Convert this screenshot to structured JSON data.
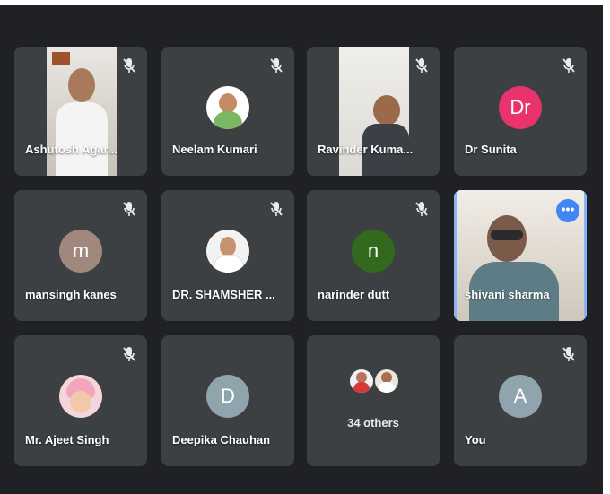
{
  "participants": [
    {
      "name": "Ashutosh Agar...",
      "type": "video",
      "muted": true
    },
    {
      "name": "Neelam Kumari",
      "type": "photo",
      "muted": true
    },
    {
      "name": "Ravinder Kuma...",
      "type": "video",
      "muted": true
    },
    {
      "name": "Dr Sunita",
      "type": "initials",
      "initials": "Dr",
      "color": "#e8336d",
      "muted": true
    },
    {
      "name": "mansingh kanes",
      "type": "initials",
      "initials": "m",
      "color": "#a1887f",
      "muted": true
    },
    {
      "name": "DR. SHAMSHER ...",
      "type": "photo",
      "muted": true
    },
    {
      "name": "narinder dutt",
      "type": "initials",
      "initials": "n",
      "color": "#33691e",
      "muted": true
    },
    {
      "name": "shivani sharma",
      "type": "video",
      "muted": false,
      "speaking": true,
      "more_icon": "more-horiz-icon"
    },
    {
      "name": "Mr. Ajeet Singh",
      "type": "photo",
      "muted": true
    },
    {
      "name": "Deepika Chauhan",
      "type": "initials",
      "initials": "D",
      "color": "#90a4ae",
      "muted": false
    },
    {
      "others_label": "34 others",
      "type": "others"
    },
    {
      "name": "You",
      "type": "initials",
      "initials": "A",
      "color": "#90a4ae",
      "muted": true
    }
  ],
  "icons": {
    "mute": "mic-off-icon",
    "more": "more-horiz-icon"
  },
  "colors": {
    "background": "#202124",
    "tile": "#3c4043",
    "active_border": "#8ab4f8"
  }
}
